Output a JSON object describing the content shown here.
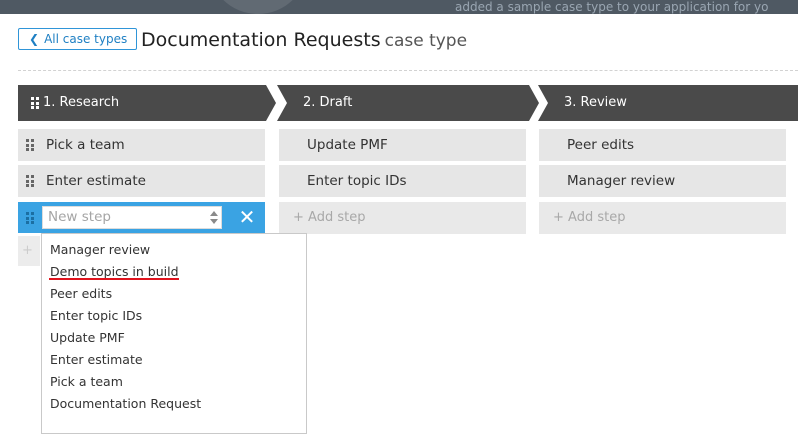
{
  "header": {
    "back_label": "All case types",
    "title": "Documentation Requests",
    "subtitle": "case type"
  },
  "background": {
    "banner_text": "added a sample case type to your application for yo"
  },
  "stages": [
    {
      "label": "1.  Research",
      "steps": [
        "Pick a team",
        "Enter estimate"
      ]
    },
    {
      "label": "2.  Draft",
      "steps": [
        "Update PMF",
        "Enter topic IDs"
      ],
      "add_step": "+ Add step"
    },
    {
      "label": "3.  Review",
      "steps": [
        "Peer edits",
        "Manager review"
      ],
      "add_step": "+ Add step"
    }
  ],
  "editor": {
    "placeholder": "New step",
    "ghost_text": "+"
  },
  "dropdown": {
    "options": [
      "Manager review",
      "Demo topics in build",
      "Peer edits",
      "Enter topic IDs",
      "Update PMF",
      "Enter estimate",
      "Pick a team",
      "Documentation Request"
    ],
    "highlighted": "Demo topics in build"
  },
  "colors": {
    "stage_bg": "#4a4a4a",
    "accent_blue": "#3aa3e3",
    "annotation_red": "#e0141e"
  }
}
